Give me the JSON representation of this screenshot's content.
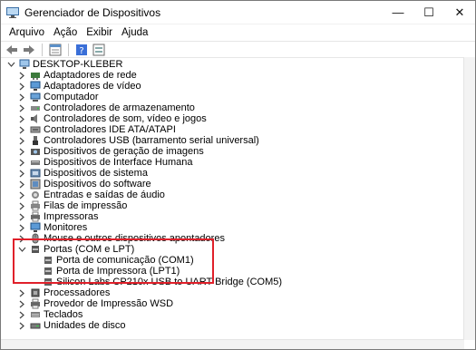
{
  "window": {
    "title": "Gerenciador de Dispositivos",
    "controls": {
      "minimize": "—",
      "maximize": "☐",
      "close": "✕"
    }
  },
  "menu": [
    "Arquivo",
    "Ação",
    "Exibir",
    "Ajuda"
  ],
  "toolbar": [
    "back-icon",
    "forward-icon",
    "properties-icon",
    "help-icon",
    "view-icon"
  ],
  "tree": {
    "root": "DESKTOP-KLEBER",
    "categories": [
      {
        "label": "Adaptadores de rede",
        "icon": "network-icon"
      },
      {
        "label": "Adaptadores de vídeo",
        "icon": "monitor-icon"
      },
      {
        "label": "Computador",
        "icon": "computer-icon"
      },
      {
        "label": "Controladores de armazenamento",
        "icon": "storage-icon"
      },
      {
        "label": "Controladores de som, vídeo e jogos",
        "icon": "speaker-icon"
      },
      {
        "label": "Controladores IDE ATA/ATAPI",
        "icon": "ide-icon"
      },
      {
        "label": "Controladores USB (barramento serial universal)",
        "icon": "usb-icon"
      },
      {
        "label": "Dispositivos de geração de imagens",
        "icon": "camera-icon"
      },
      {
        "label": "Dispositivos de Interface Humana",
        "icon": "hid-icon"
      },
      {
        "label": "Dispositivos de sistema",
        "icon": "system-icon"
      },
      {
        "label": "Dispositivos do software",
        "icon": "software-icon"
      },
      {
        "label": "Entradas e saídas de áudio",
        "icon": "audio-icon"
      },
      {
        "label": "Filas de impressão",
        "icon": "printer-queue-icon"
      },
      {
        "label": "Impressoras",
        "icon": "printer-icon"
      },
      {
        "label": "Monitores",
        "icon": "monitor-icon"
      },
      {
        "label": "Mouse e outros dispositivos apontadores",
        "icon": "mouse-icon"
      },
      {
        "label": "Portas (COM e LPT)",
        "icon": "port-icon",
        "expanded": true,
        "children": [
          "Porta de comunicação (COM1)",
          "Porta de Impressora (LPT1)",
          "Silicon Labs CP210x USB to UART Bridge (COM5)"
        ]
      },
      {
        "label": "Processadores",
        "icon": "cpu-icon"
      },
      {
        "label": "Provedor de Impressão WSD",
        "icon": "printer-icon"
      },
      {
        "label": "Teclados",
        "icon": "keyboard-icon"
      },
      {
        "label": "Unidades de disco",
        "icon": "disk-icon"
      }
    ]
  }
}
